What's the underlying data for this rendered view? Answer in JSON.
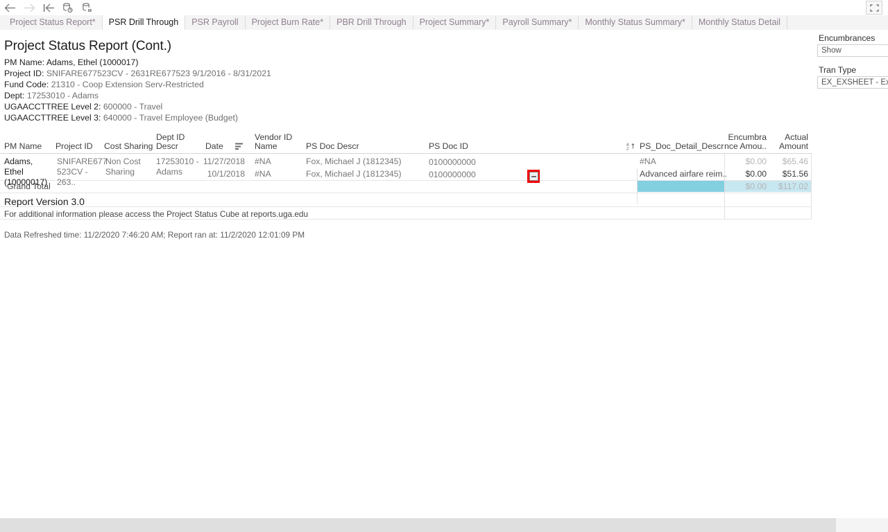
{
  "toolbar": {
    "buttons": [
      {
        "name": "back-icon",
        "title": "Back",
        "enabled": true
      },
      {
        "name": "forward-icon",
        "title": "Forward",
        "enabled": false
      },
      {
        "name": "revert-icon",
        "title": "Revert",
        "enabled": true
      },
      {
        "name": "refresh-icon",
        "title": "Refresh",
        "enabled": true
      },
      {
        "name": "pause-icon",
        "title": "Pause Auto Updates",
        "enabled": true
      }
    ],
    "fullscreen_title": "Full Screen"
  },
  "tabs": [
    {
      "label": "Project Status Report*",
      "active": false
    },
    {
      "label": "PSR Drill Through",
      "active": true
    },
    {
      "label": "PSR Payroll",
      "active": false
    },
    {
      "label": "Project Burn Rate*",
      "active": false
    },
    {
      "label": "PBR Drill Through",
      "active": false
    },
    {
      "label": "Project Summary*",
      "active": false
    },
    {
      "label": "Payroll Summary*",
      "active": false
    },
    {
      "label": "Monthly Status Summary*",
      "active": false
    },
    {
      "label": "Monthly Status Detail",
      "active": false
    }
  ],
  "report": {
    "title": "Project Status Report (Cont.)",
    "meta": [
      {
        "label": "PM Name:",
        "value": "Adams, Ethel (1000017)",
        "emphasis": "dark"
      },
      {
        "label": "Project ID:",
        "value": "SNIFARE677523CV - 2631RE677523 9/1/2016 - 8/31/2021",
        "emphasis": "light"
      },
      {
        "label": "Fund Code:",
        "value": "21310 - Coop Extension Serv-Restricted",
        "emphasis": "light"
      },
      {
        "label": "Dept:",
        "value": "17253010 - Adams",
        "emphasis": "light"
      },
      {
        "label": "UGAACCTTREE Level 2:",
        "value": "600000 - Travel",
        "emphasis": "light"
      },
      {
        "label": "UGAACCTTREE Level 3:",
        "value": "640000 - Travel Employee (Budget)",
        "emphasis": "light"
      }
    ],
    "columns": [
      {
        "key": "pm_name",
        "header": "PM Name"
      },
      {
        "key": "project_id",
        "header": "Project ID"
      },
      {
        "key": "cost_sharing",
        "header": "Cost Sharing"
      },
      {
        "key": "dept_id_descr",
        "header": "Dept ID\nDescr"
      },
      {
        "key": "date",
        "header": "Date"
      },
      {
        "key": "vendor_id_name",
        "header": "Vendor ID\nName"
      },
      {
        "key": "ps_doc_descr",
        "header": "PS Doc Descr"
      },
      {
        "key": "ps_doc_id",
        "header": "PS Doc ID"
      },
      {
        "key": "ps_doc_detail_descr",
        "header": "PS_Doc_Detail_Descr"
      },
      {
        "key": "encumbrance_amount",
        "header": "Encumbra\nnce Amou.."
      },
      {
        "key": "actual_amount",
        "header": "Actual\nAmount"
      }
    ],
    "rows": [
      {
        "pm_name": "Adams, Ethel\n(10000017)",
        "project_id": "SNIFARE677\n523CV - 263..",
        "cost_sharing": "Non Cost\nSharing",
        "dept_id_descr": "17253010 -\nAdams",
        "date": "11/27/2018",
        "vendor_id_name": "#NA",
        "ps_doc_descr": "Fox, Michael J (1812345)",
        "ps_doc_id": "0100000000",
        "ps_doc_detail_descr": "#NA",
        "encumbrance_amount": "$0.00",
        "actual_amount": "$65.46",
        "highlighted": false
      },
      {
        "pm_name": "",
        "project_id": "",
        "cost_sharing": "",
        "dept_id_descr": "",
        "date": "10/1/2018",
        "vendor_id_name": "#NA",
        "ps_doc_descr": "Fox, Michael J (1812345)",
        "ps_doc_id": "0100000000",
        "ps_doc_detail_descr": "Advanced airfare reim..",
        "encumbrance_amount": "$0.00",
        "actual_amount": "$51.56",
        "highlighted": true
      }
    ],
    "grand_total": {
      "label": "Grand Total",
      "encumbrance_amount": "$0.00",
      "actual_amount": "$117.02"
    },
    "icons": {
      "date_sort": "sort-descending-icon",
      "detail_sort": "sort-alpha-ascending-icon",
      "collapse": "collapse-minus-icon"
    },
    "footer": {
      "version": "Report Version 3.0",
      "info": "For additional information please access the Project Status Cube at reports.uga.edu",
      "timestamps": "Data Refreshed time: 11/2/2020 7:46:20 AM; Report ran at: 11/2/2020 12:01:09 PM"
    }
  },
  "filters": [
    {
      "label": "Encumbrances",
      "value": "Show"
    },
    {
      "label": "Tran Type",
      "value": "EX_EXSHEET - Exp"
    }
  ],
  "colors": {
    "highlight_teal": "#82cfe0",
    "highlight_light_blue": "#c7e7f1",
    "focus_red": "#f20000",
    "tab_inactive_text": "#8f7f8f"
  }
}
